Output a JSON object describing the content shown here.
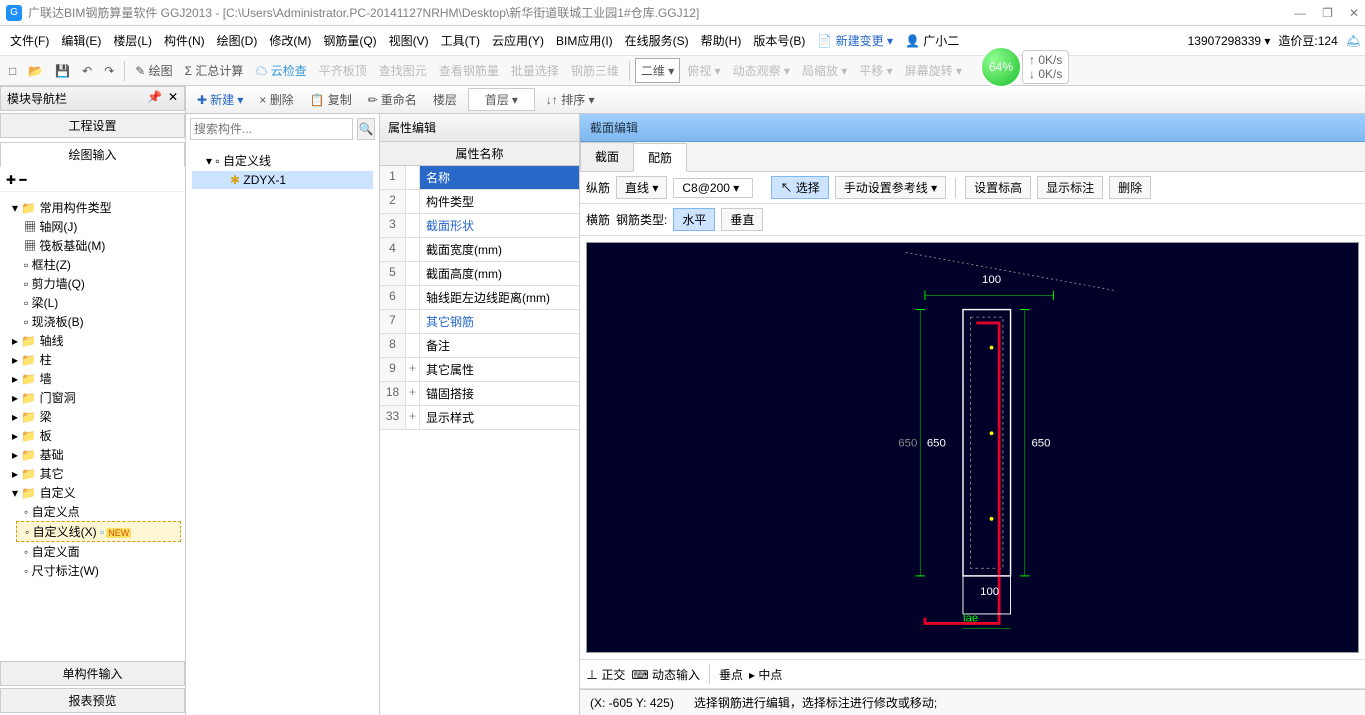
{
  "window": {
    "title": "广联达BIM钢筋算量软件 GGJ2013 - [C:\\Users\\Administrator.PC-20141127NRHM\\Desktop\\新华街道联城工业园1#仓库.GGJ12]"
  },
  "header_right": {
    "phone": "13907298339 ▾",
    "credits": "造价豆:124",
    "bean_icon": "🔵"
  },
  "menus": [
    "文件(F)",
    "编辑(E)",
    "楼层(L)",
    "构件(N)",
    "绘图(D)",
    "修改(M)",
    "钢筋量(Q)",
    "视图(V)",
    "工具(T)",
    "云应用(Y)",
    "BIM应用(I)",
    "在线服务(S)",
    "帮助(H)",
    "版本号(B)"
  ],
  "menu_extra": {
    "new_change": "新建变更 ▾",
    "user": "广小二"
  },
  "toolbar1": {
    "new": "□",
    "open": "📂",
    "save": "💾",
    "undo": "↶",
    "redo": "↷",
    "draw": "✎ 绘图",
    "sigma": "Σ 汇总计算",
    "cloud": "☁ 云检查",
    "t1": "平齐板顶",
    "t2": "查找图元",
    "t3": "查看钢筋量",
    "t4": "批量选择",
    "t5": "钢筋三维",
    "view_dd": "二维 ▾",
    "fv": "俯视 ▾",
    "dyn": "动态观察 ▾",
    "local": "局缩放 ▾",
    "pan": "平移 ▾",
    "rot": "屏幕旋转 ▾"
  },
  "toolbar2": {
    "new": "新建 ▾",
    "del": "× 删除",
    "copy": "复制",
    "rename": "重命名",
    "floor": "楼层",
    "floor_sel": "首层",
    "sort": "↓↑ 排序 ▾"
  },
  "float": {
    "pct": "64%",
    "up": "0K/s",
    "down": "0K/s"
  },
  "left": {
    "title": "模块导航栏",
    "tab1": "工程设置",
    "tab2": "绘图输入",
    "tools": "✚ ━",
    "tree": {
      "root": "常用构件类型",
      "items": [
        "轴网(J)",
        "筏板基础(M)",
        "框柱(Z)",
        "剪力墙(Q)",
        "梁(L)",
        "现浇板(B)"
      ],
      "cats": [
        "轴线",
        "柱",
        "墙",
        "门窗洞",
        "梁",
        "板",
        "基础",
        "其它"
      ],
      "custom": "自定义",
      "custom_items": [
        "自定义点",
        "自定义线(X)",
        "自定义面",
        "尺寸标注(W)"
      ],
      "new_tag": "NEW"
    },
    "foot1": "单构件输入",
    "foot2": "报表预览"
  },
  "mid": {
    "search_ph": "搜索构件...",
    "root": "自定义线",
    "item": "ZDYX-1"
  },
  "prop": {
    "title": "属性编辑",
    "col": "属性名称",
    "rows": [
      {
        "n": "1",
        "name": "名称",
        "link": true,
        "sel": true,
        "exp": ""
      },
      {
        "n": "2",
        "name": "构件类型",
        "exp": ""
      },
      {
        "n": "3",
        "name": "截面形状",
        "link": true,
        "exp": ""
      },
      {
        "n": "4",
        "name": "截面宽度(mm)",
        "exp": ""
      },
      {
        "n": "5",
        "name": "截面高度(mm)",
        "exp": ""
      },
      {
        "n": "6",
        "name": "轴线距左边线距离(mm)",
        "exp": ""
      },
      {
        "n": "7",
        "name": "其它钢筋",
        "link": true,
        "exp": ""
      },
      {
        "n": "8",
        "name": "备注",
        "exp": ""
      },
      {
        "n": "9",
        "name": "其它属性",
        "exp": "+"
      },
      {
        "n": "18",
        "name": "锚固搭接",
        "exp": "+"
      },
      {
        "n": "33",
        "name": "显示样式",
        "exp": "+"
      }
    ]
  },
  "editor": {
    "title": "截面编辑",
    "tab1": "截面",
    "tab2": "配筋",
    "bar1": {
      "lbl": "纵筋",
      "line": "直线 ▾",
      "spec": "C8@200",
      "select": "选择",
      "ref": "手动设置参考线 ▾",
      "elev": "设置标高",
      "mark": "显示标注",
      "del": "删除"
    },
    "bar2": {
      "lbl": "横筋",
      "typelbl": "钢筋类型:",
      "hz": "水平",
      "vt": "垂直"
    },
    "canvas": {
      "top": "100",
      "left": "650",
      "left2": "650",
      "right": "650",
      "bottom": "100",
      "lae": "lae"
    },
    "bottom": {
      "ortho": "正交",
      "dyn": "动态输入",
      "snap1": "垂点",
      "snap2": "中点"
    },
    "status": {
      "coords": "(X: -605 Y: 425)",
      "hint": "选择钢筋进行编辑，选择标注进行修改或移动;"
    }
  }
}
